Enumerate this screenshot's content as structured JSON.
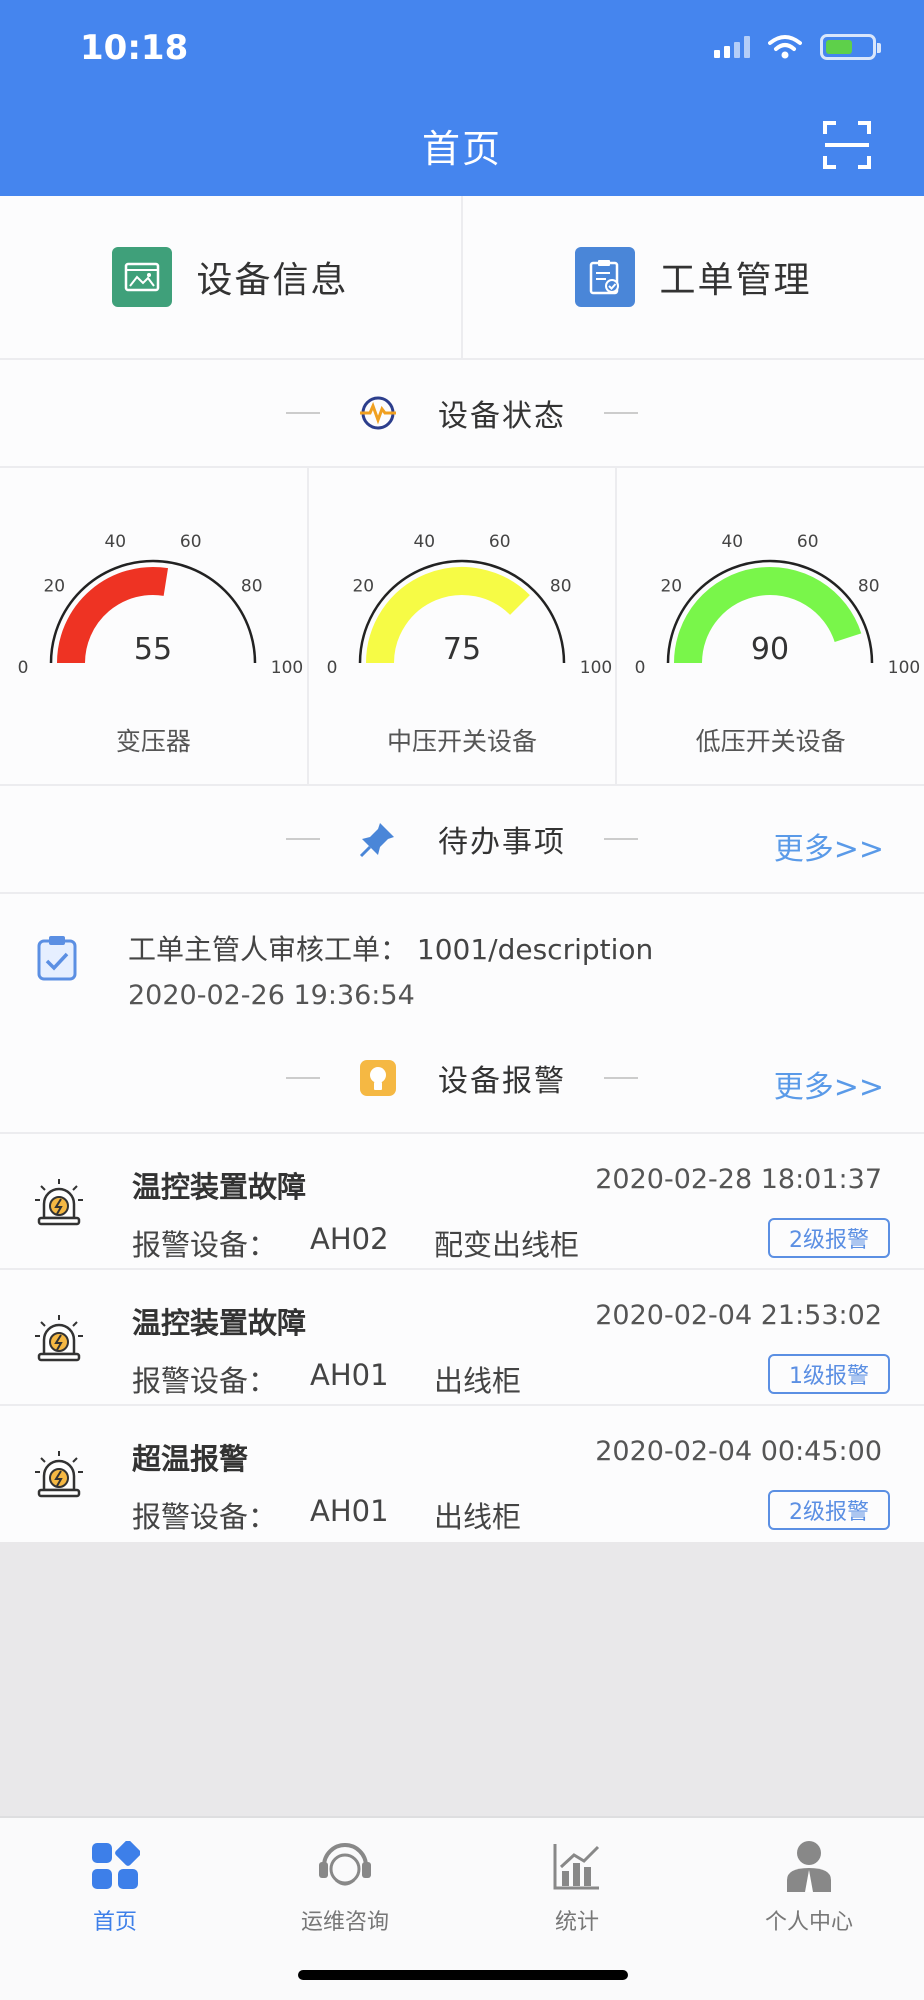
{
  "status": {
    "time": "10:18"
  },
  "header": {
    "title": "首页"
  },
  "quick": [
    {
      "label": "设备信息",
      "color": "#3fa07a"
    },
    {
      "label": "工单管理",
      "color": "#4a86d8"
    }
  ],
  "status_section": {
    "title": "设备状态"
  },
  "gauges": [
    {
      "label": "变压器",
      "value": 55,
      "color": "#ee3323"
    },
    {
      "label": "中压开关设备",
      "value": 75,
      "color": "#f6fb45"
    },
    {
      "label": "低压开关设备",
      "value": 90,
      "color": "#79f64a"
    }
  ],
  "gauge_ticks": [
    "0",
    "20",
    "40",
    "60",
    "80",
    "100"
  ],
  "todo_section": {
    "title": "待办事项",
    "more": "更多>>"
  },
  "todo": {
    "title": "工单主管人审核工单：  1001/description",
    "time": "2020-02-26 19:36:54"
  },
  "alarm_section": {
    "title": "设备报警",
    "more": "更多>>"
  },
  "alarms": [
    {
      "title": "温控装置故障",
      "time": "2020-02-28 18:01:37",
      "device_label": "报警设备：",
      "code": "AH02",
      "cabinet": "配变出线柜",
      "level": "2级报警"
    },
    {
      "title": "温控装置故障",
      "time": "2020-02-04 21:53:02",
      "device_label": "报警设备：",
      "code": "AH01",
      "cabinet": "出线柜",
      "level": "1级报警"
    },
    {
      "title": "超温报警",
      "time": "2020-02-04 00:45:00",
      "device_label": "报警设备：",
      "code": "AH01",
      "cabinet": "出线柜",
      "level": "2级报警"
    }
  ],
  "tabs": [
    {
      "label": "首页",
      "active": true
    },
    {
      "label": "运维咨询",
      "active": false
    },
    {
      "label": "统计",
      "active": false
    },
    {
      "label": "个人中心",
      "active": false
    }
  ]
}
